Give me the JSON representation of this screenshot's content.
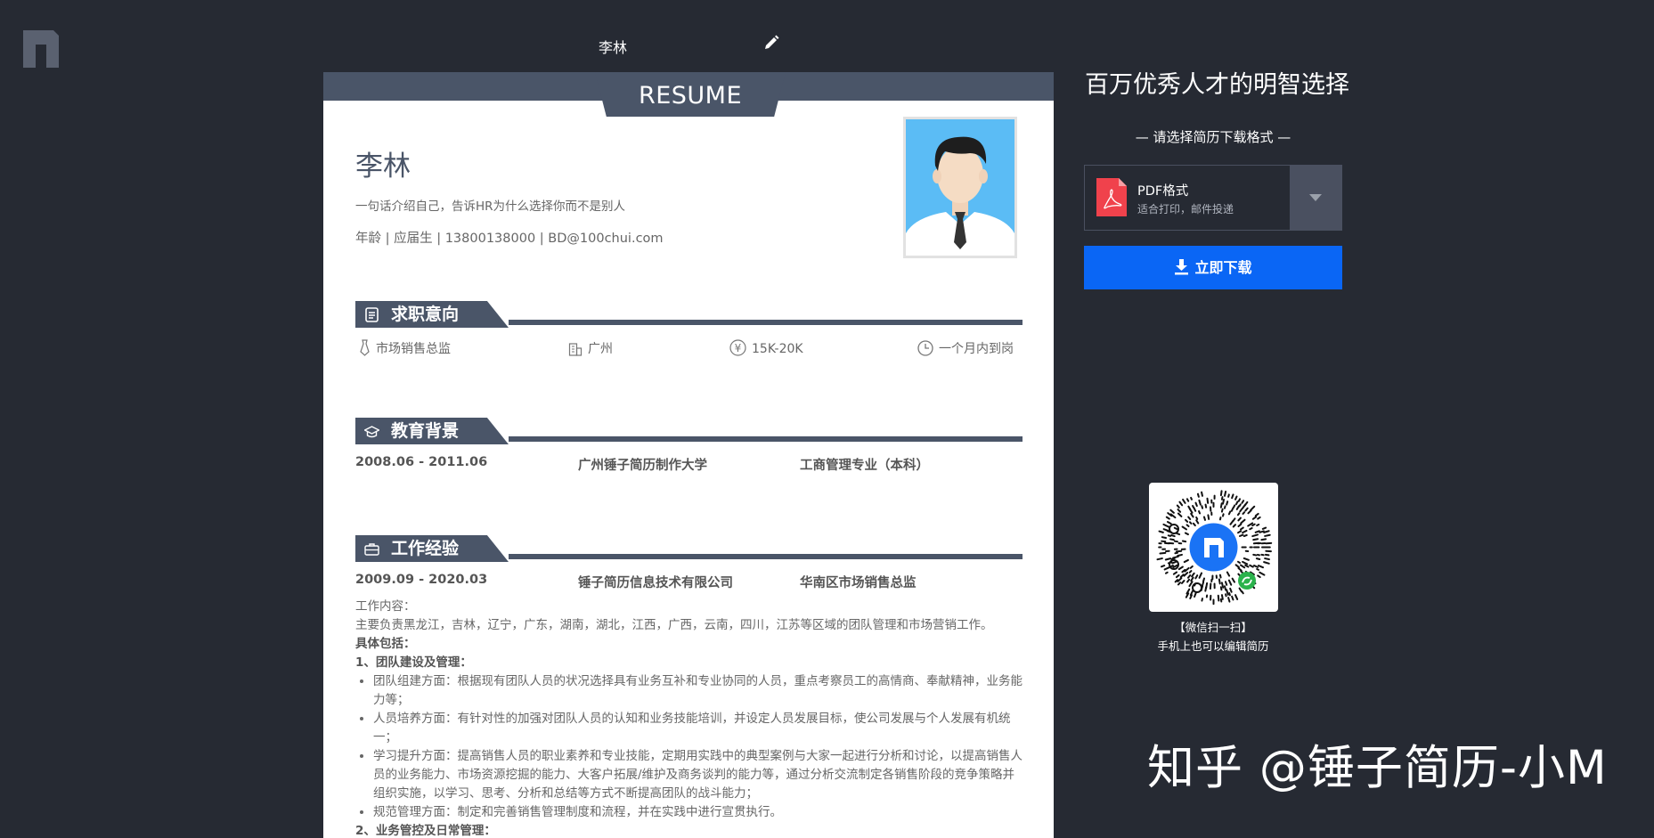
{
  "topbar": {
    "resume_name": "李林"
  },
  "resume": {
    "header_label": "RESUME",
    "name": "李林",
    "tagline": "一句话介绍自己，告诉HR为什么选择你而不是别人",
    "contact": "年龄 | 应届生 | 13800138000 | BD@100chui.com",
    "sections": {
      "intent": "求职意向",
      "education": "教育背景",
      "work": "工作经验"
    },
    "intent": {
      "position": "市场销售总监",
      "city": "广州",
      "salary": "15K-20K",
      "availability": "一个月内到岗"
    },
    "education": {
      "period": "2008.06 - 2011.06",
      "school": "广州锤子简历制作大学",
      "major": "工商管理专业（本科）"
    },
    "work": {
      "period": "2009.09 - 2020.03",
      "company": "锤子简历信息技术有限公司",
      "title": "华南区市场销售总监",
      "content_label": "工作内容：",
      "summary": "主要负责黑龙江，吉林，辽宁，广东，湖南，湖北，江西，广西，云南，四川，江苏等区域的团队管理和市场营销工作。",
      "includes": "具体包括：",
      "sub1": "1、团队建设及管理：",
      "bullets": [
        "团队组建方面：根据现有团队人员的状况选择具有业务互补和专业协同的人员，重点考察员工的高情商、奉献精神，业务能力等；",
        "人员培养方面：有针对性的加强对团队人员的认知和业务技能培训，并设定人员发展目标，使公司发展与个人发展有机统一；",
        "学习提升方面：提高销售人员的职业素养和专业技能，定期用实践中的典型案例与大家一起进行分析和讨论，以提高销售人员的业务能力、市场资源挖掘的能力、大客户拓展/维护及商务谈判的能力等，通过分析交流制定各销售阶段的竞争策略并组织实施，以学习、思考、分析和总结等方式不断提高团队的战斗能力；",
        "规范管理方面：制定和完善销售管理制度和流程，并在实践中进行宣贯执行。"
      ],
      "sub2": "2、业务管控及日常管理："
    }
  },
  "panel": {
    "slogan": "百万优秀人才的明智选择",
    "choose_format": "— 请选择简历下载格式 —",
    "format_title": "PDF格式",
    "format_subtitle": "适合打印，邮件投递",
    "download_label": "立即下载",
    "qr_line1": "【微信扫一扫】",
    "qr_line2": "手机上也可以编辑简历"
  },
  "watermark": "知乎 @锤子简历-小M",
  "colors": {
    "background": "#262a33",
    "accent": "#4a5568",
    "download_button": "#0a66f5",
    "pdf_red": "#f0424c"
  },
  "icons": [
    "logo-icon",
    "edit-pencil-icon",
    "tie-icon",
    "building-icon",
    "yen-icon",
    "clock-icon",
    "document-icon",
    "graduation-cap-icon",
    "briefcase-icon",
    "pdf-icon",
    "chevron-down-icon",
    "download-icon",
    "qr-code-icon"
  ]
}
